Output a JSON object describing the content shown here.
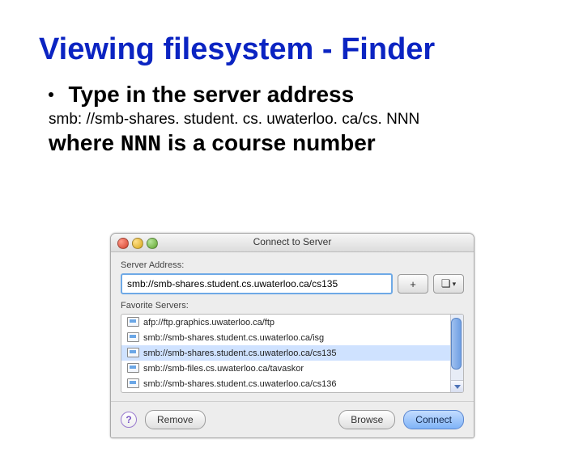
{
  "slide": {
    "title": "Viewing filesystem - Finder",
    "bullet": "Type in the server address",
    "address_example": "smb: //smb-shares. student. cs. uwaterloo. ca/cs. NNN",
    "where_prefix": "where ",
    "where_nnn": "NNN",
    "where_suffix": " is a course number"
  },
  "dialog": {
    "title": "Connect to Server",
    "server_address_label": "Server Address:",
    "address_value": "smb://smb-shares.student.cs.uwaterloo.ca/cs135",
    "plus_label": "+",
    "history_glyph": "❏",
    "favorites_label": "Favorite Servers:",
    "favorites": [
      "afp://ftp.graphics.uwaterloo.ca/ftp",
      "smb://smb-shares.student.cs.uwaterloo.ca/isg",
      "smb://smb-shares.student.cs.uwaterloo.ca/cs135",
      "smb://smb-files.cs.uwaterloo.ca/tavaskor",
      "smb://smb-shares.student.cs.uwaterloo.ca/cs136"
    ],
    "selected_index": 2,
    "help_glyph": "?",
    "remove_label": "Remove",
    "browse_label": "Browse",
    "connect_label": "Connect"
  }
}
